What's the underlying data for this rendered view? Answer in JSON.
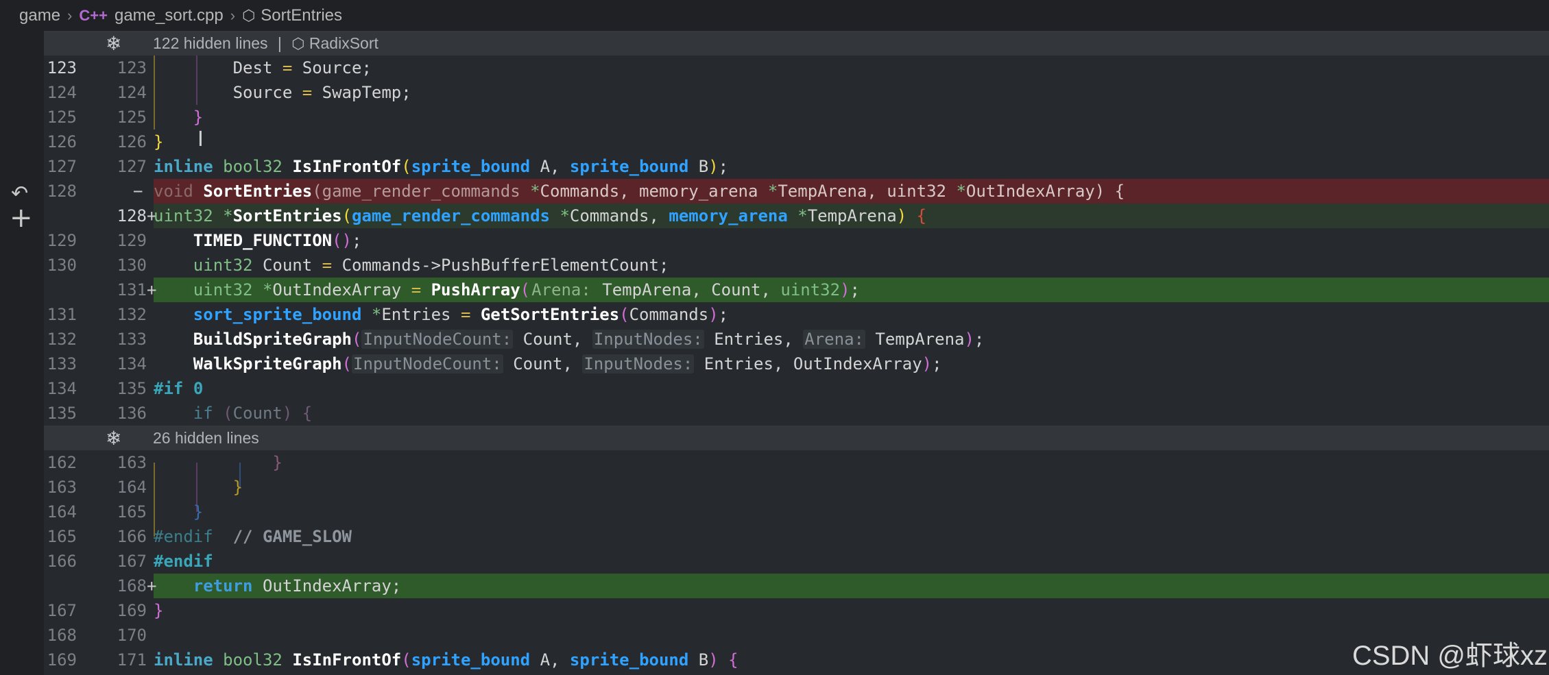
{
  "breadcrumb": {
    "items": [
      "game",
      "game_sort.cpp",
      "SortEntries"
    ],
    "file_icon": "C++",
    "symbol_icon": "cube-icon"
  },
  "gutter": {
    "revert_icon": "revert-icon",
    "add_icon": "plus-icon"
  },
  "hidden_sections": [
    {
      "text": "122 hidden lines",
      "symbol": "RadixSort"
    },
    {
      "text": "26 hidden lines"
    }
  ],
  "lines": {
    "l1": {
      "old": "123",
      "new": "123"
    },
    "l2": {
      "old": "124",
      "new": "124"
    },
    "l3": {
      "old": "125",
      "new": "125"
    },
    "l4": {
      "old": "126",
      "new": "126"
    },
    "l5": {
      "old": "127",
      "new": "127"
    },
    "l6": {
      "old": "128",
      "new": "",
      "mark": "−"
    },
    "l7": {
      "old": "",
      "new": "128",
      "mark": "+"
    },
    "l8": {
      "old": "129",
      "new": "129"
    },
    "l9": {
      "old": "130",
      "new": "130"
    },
    "l10": {
      "old": "",
      "new": "131",
      "mark": "+"
    },
    "l11": {
      "old": "131",
      "new": "132"
    },
    "l12": {
      "old": "132",
      "new": "133"
    },
    "l13": {
      "old": "133",
      "new": "134"
    },
    "l14": {
      "old": "134",
      "new": "135"
    },
    "l15": {
      "old": "135",
      "new": "136"
    },
    "l16": {
      "old": "162",
      "new": "163"
    },
    "l17": {
      "old": "163",
      "new": "164"
    },
    "l18": {
      "old": "164",
      "new": "165"
    },
    "l19": {
      "old": "165",
      "new": "166"
    },
    "l20": {
      "old": "166",
      "new": "167"
    },
    "l21": {
      "old": "",
      "new": "168",
      "mark": "+"
    },
    "l22": {
      "old": "167",
      "new": "169"
    },
    "l23": {
      "old": "168",
      "new": "170"
    },
    "l24": {
      "old": "169",
      "new": "171"
    }
  },
  "code": {
    "l1": "        Dest = Source;",
    "l2": "        Source = SwapTemp;",
    "l3": "    }",
    "l4": "}",
    "l5": "inline bool32 IsInFrontOf(sprite_bound A, sprite_bound B);",
    "l6": "void SortEntries(game_render_commands *Commands, memory_arena *TempArena, uint32 *OutIndexArray) {",
    "l7": "uint32 *SortEntries(game_render_commands *Commands, memory_arena *TempArena) {",
    "l8": "    TIMED_FUNCTION();",
    "l9": "    uint32 Count = Commands->PushBufferElementCount;",
    "l10": "    uint32 *OutIndexArray = PushArray(Arena: TempArena, Count, uint32);",
    "l11": "    sort_sprite_bound *Entries = GetSortEntries(Commands);",
    "l12": "    BuildSpriteGraph(InputNodeCount: Count, InputNodes: Entries, Arena: TempArena);",
    "l13": "    WalkSpriteGraph(InputNodeCount: Count, InputNodes: Entries, OutIndexArray);",
    "l14": "#if 0",
    "l15": "    if (Count) {",
    "l16": "            }",
    "l17": "        }",
    "l18": "    }",
    "l19": "#endif  // GAME_SLOW",
    "l20": "#endif",
    "l21": "    return OutIndexArray;",
    "l22": "}",
    "l23": "",
    "l24": "inline bool32 IsInFrontOf(sprite_bound A, sprite_bound B) {"
  },
  "watermark": "CSDN @虾球xz",
  "colors": {
    "added": "#2f5a2a",
    "removed": "#5a2428",
    "changed": "#2b3a2d",
    "keyword": "#3d9de0",
    "type_bold": "#2fa3ff",
    "type": "#7fbf86"
  }
}
